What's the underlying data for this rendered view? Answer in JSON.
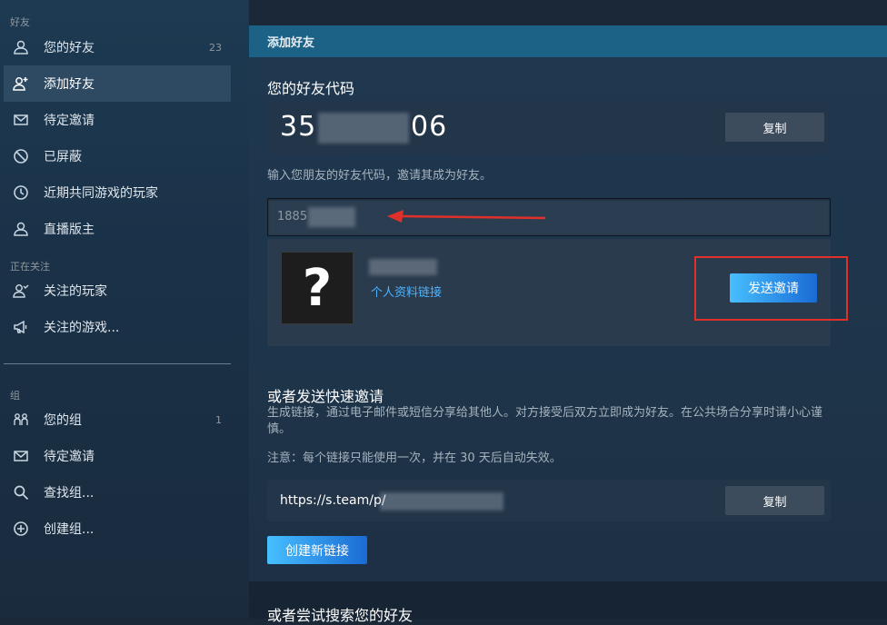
{
  "sidebar": {
    "friends_section": "好友",
    "friends_items": [
      {
        "label": "您的好友",
        "count": "23",
        "icon": "person-icon"
      },
      {
        "label": "添加好友",
        "count": "",
        "icon": "add-friend-icon"
      },
      {
        "label": "待定邀请",
        "count": "",
        "icon": "envelope-icon"
      },
      {
        "label": "已屏蔽",
        "count": "",
        "icon": "blocked-icon"
      },
      {
        "label": "近期共同游戏的玩家",
        "count": "",
        "icon": "clock-icon"
      },
      {
        "label": "直播版主",
        "count": "",
        "icon": "person-icon"
      }
    ],
    "following_section": "正在关注",
    "following_items": [
      {
        "label": "关注的玩家",
        "icon": "follow-person-icon"
      },
      {
        "label": "关注的游戏...",
        "icon": "megaphone-icon"
      }
    ],
    "groups_section": "组",
    "groups_items": [
      {
        "label": "您的组",
        "count": "1",
        "icon": "group-icon"
      },
      {
        "label": "待定邀请",
        "count": "",
        "icon": "envelope-icon"
      },
      {
        "label": "查找组...",
        "count": "",
        "icon": "search-icon"
      },
      {
        "label": "创建组...",
        "count": "",
        "icon": "plus-circle-icon"
      }
    ]
  },
  "main": {
    "header": "添加好友",
    "friend_code_title": "您的好友代码",
    "friend_code_prefix": "35",
    "friend_code_suffix": "06",
    "copy_label": "复制",
    "enter_code_hint": "输入您朋友的好友代码，邀请其成为好友。",
    "input_value": "1885",
    "profile_link": "个人资料链接",
    "avatar_glyph": "?",
    "send_invite_label": "发送邀请",
    "quick_invite_title": "或者发送快速邀请",
    "quick_invite_desc": "生成链接，通过电子邮件或短信分享给其他人。对方接受后双方立即成为好友。在公共场合分享时请小心谨慎。",
    "quick_invite_note": "注意：每个链接只能使用一次，并在 30 天后自动失效。",
    "invite_link": "https://s.team/p/",
    "link_copy_label": "复制",
    "create_link_label": "创建新链接",
    "search_title": "或者尝试搜索您的好友"
  },
  "colors": {
    "accent_blue": "#1a9fff",
    "header_bar": "#1c6287",
    "annotation_red": "#e0302a"
  }
}
